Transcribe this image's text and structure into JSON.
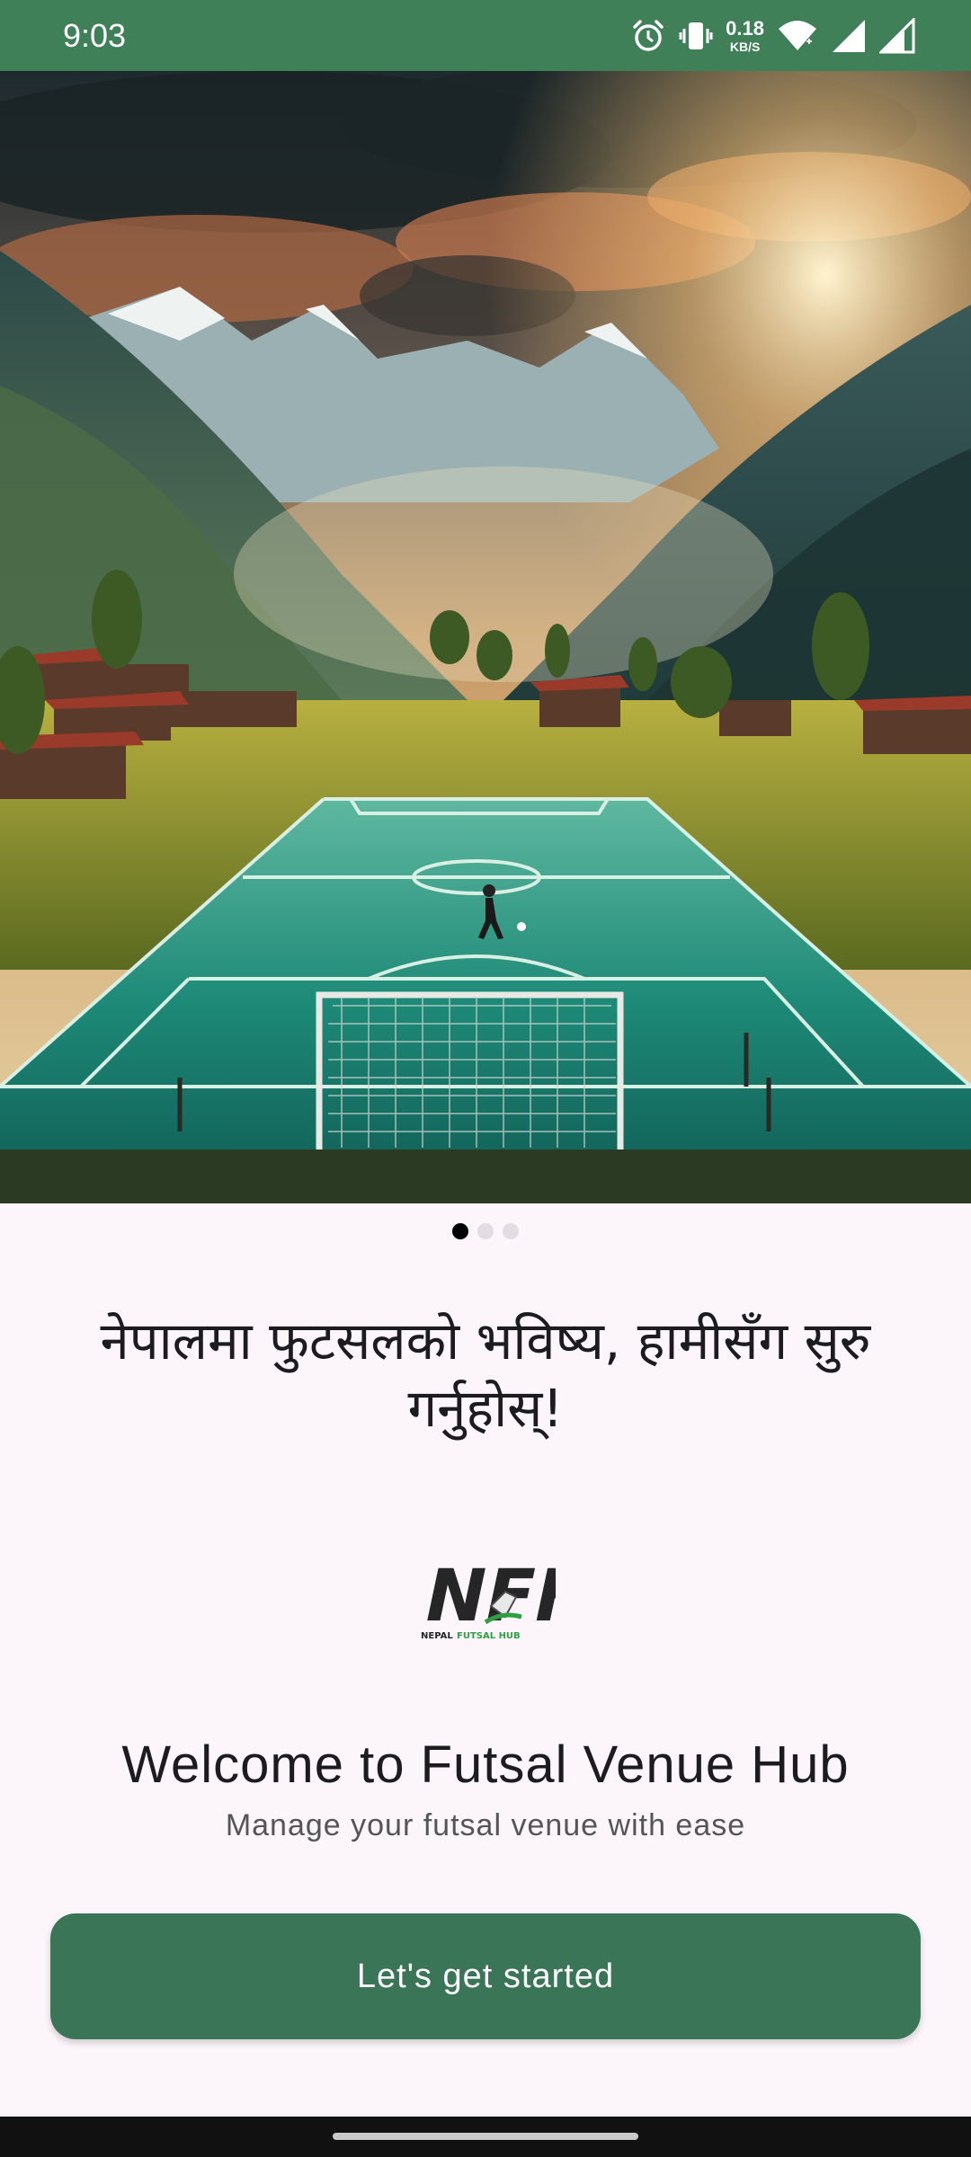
{
  "status_bar": {
    "time": "9:03",
    "net_speed_value": "0.18",
    "net_speed_unit": "KB/S",
    "icons": [
      "alarm-icon",
      "vibrate-icon",
      "wifi-icon",
      "signal-icon",
      "signal-icon"
    ]
  },
  "hero": {
    "image": "illustration-futsal-field-mountains"
  },
  "pager": {
    "total": 3,
    "active_index": 0
  },
  "tagline": "नेपालमा फुटसलको भविष्य, हामीसँग सुरु गर्नुहोस्!",
  "logo": {
    "mark": "NFH",
    "text_left": "NEPAL",
    "text_right": "FUTSAL HUB"
  },
  "welcome_title": "Welcome to Futsal Venue Hub",
  "welcome_subtitle": "Manage your futsal venue with ease",
  "cta_label": "Let's get started",
  "colors": {
    "status_bar": "#3f8058",
    "button": "#3a7558",
    "background": "#fcf6fb"
  }
}
